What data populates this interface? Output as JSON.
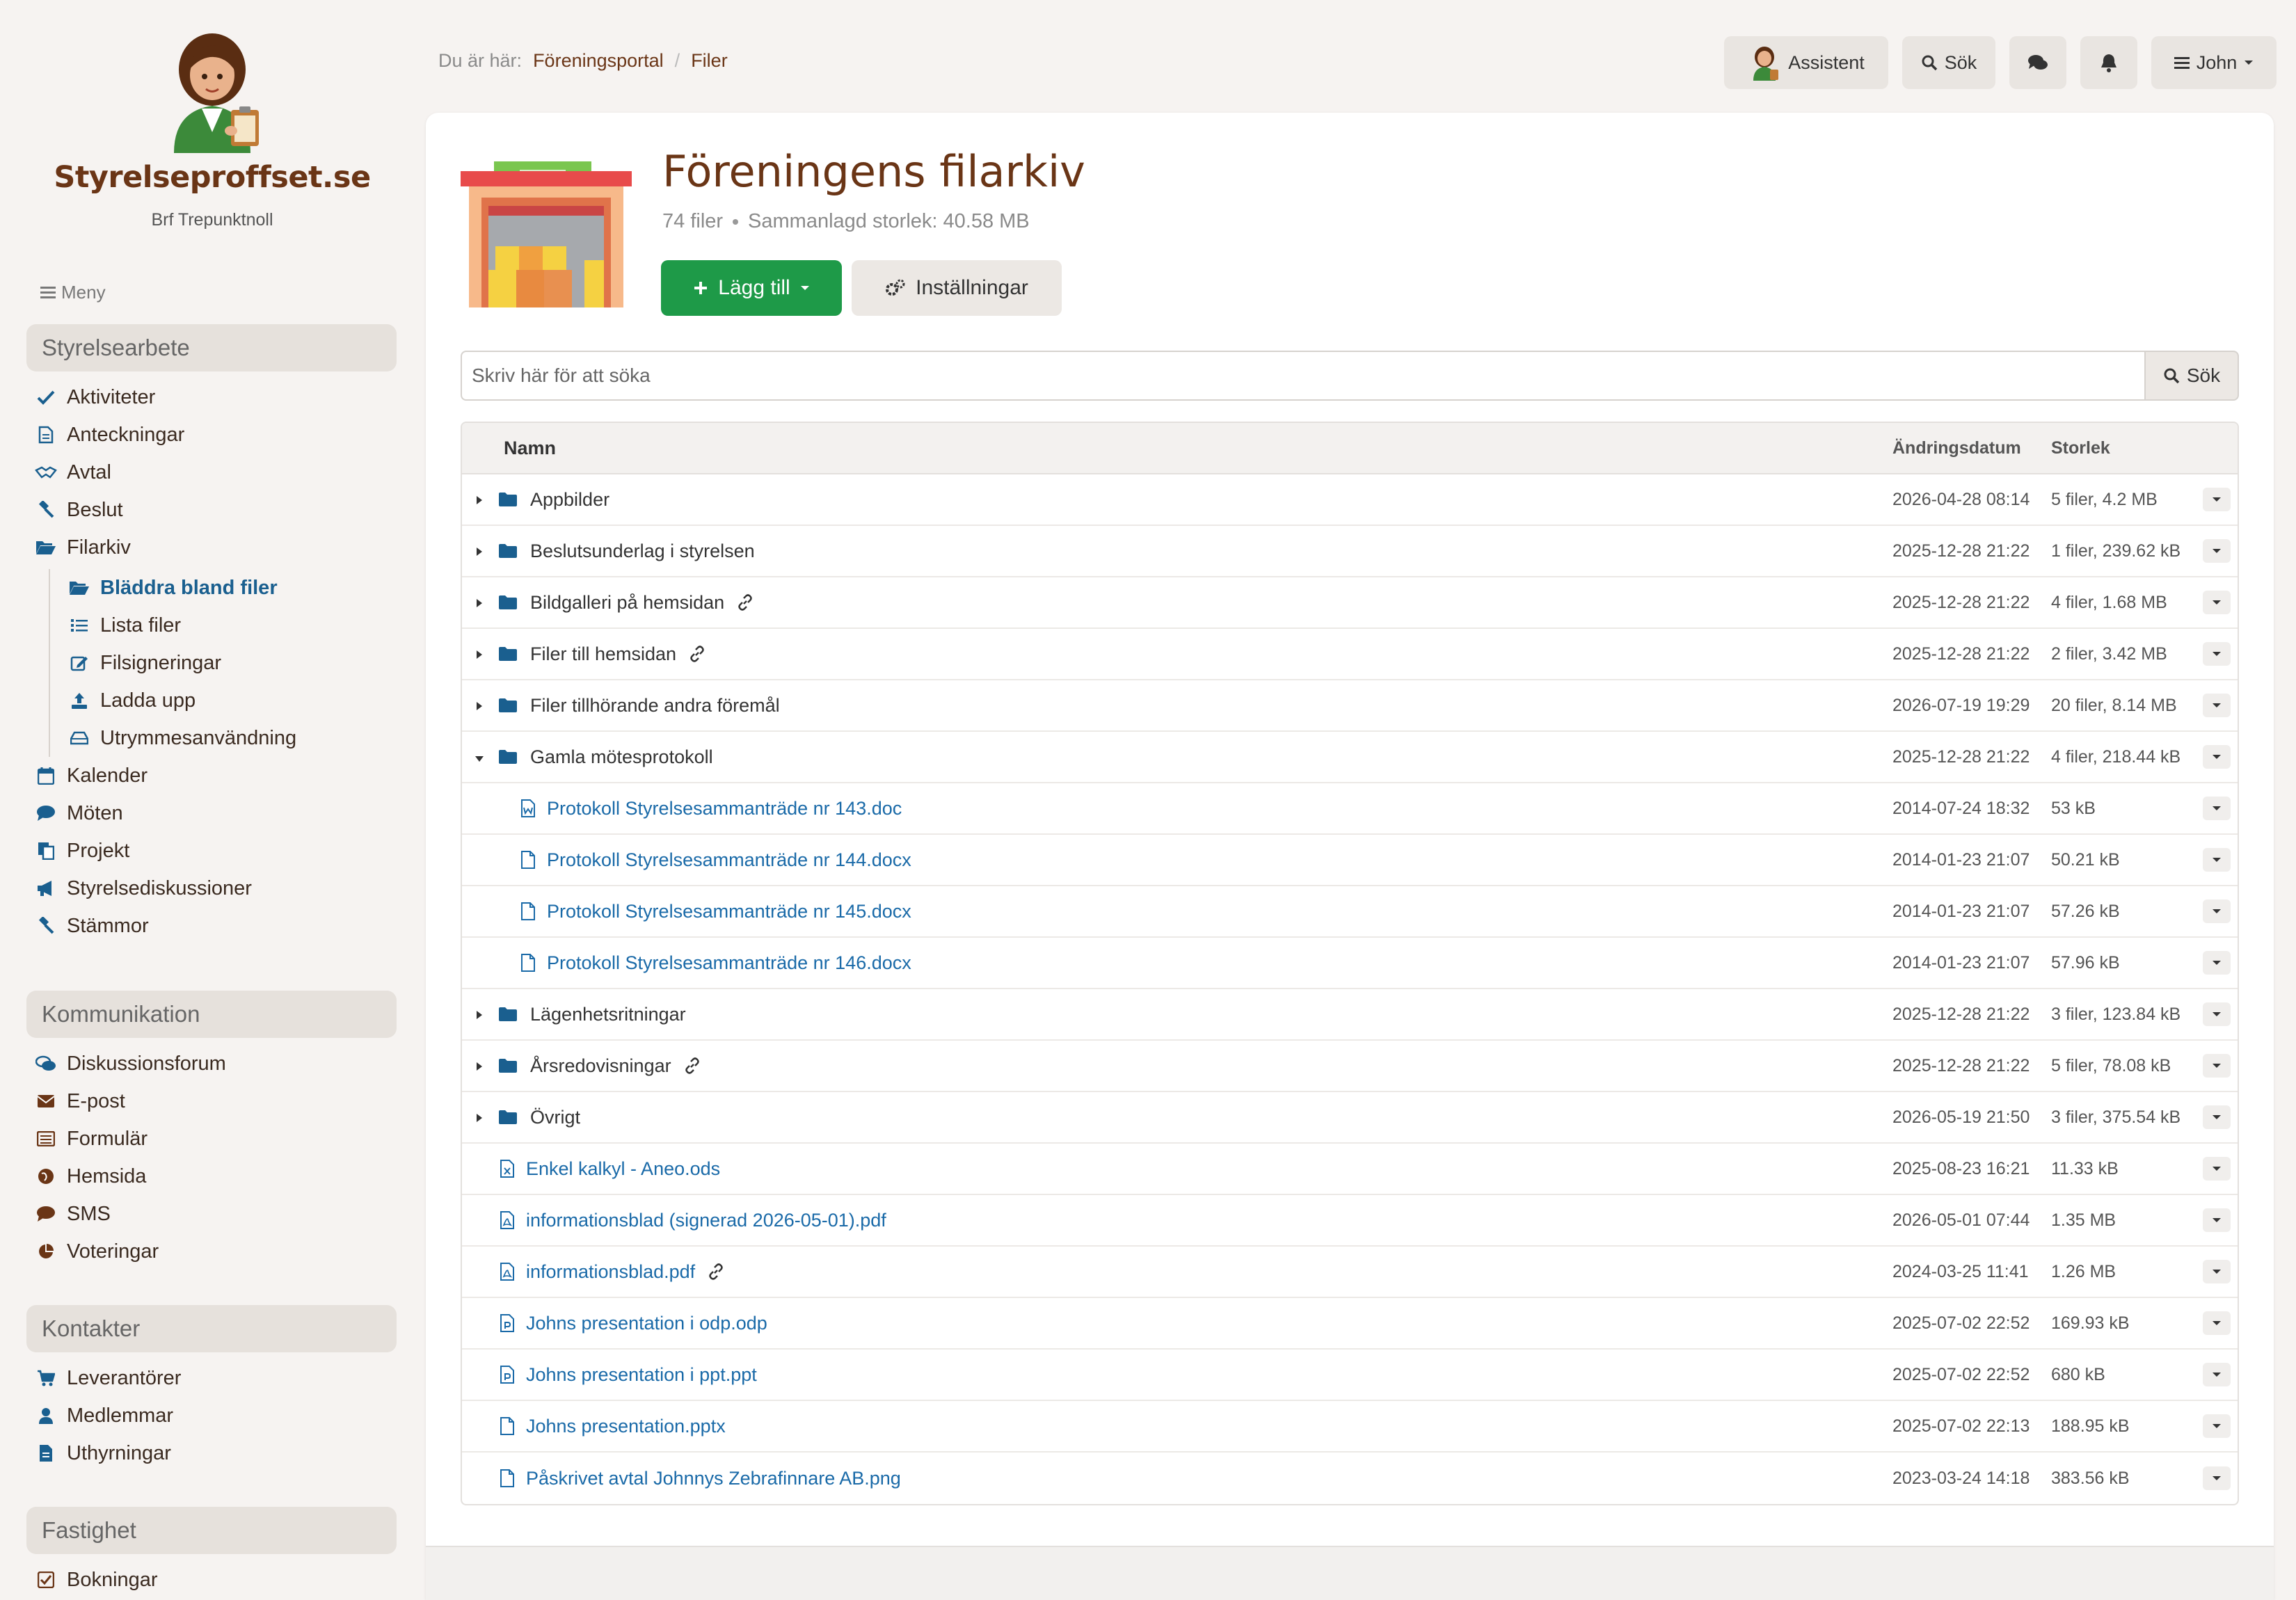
{
  "brand": {
    "name": "Styrelseproffset.se",
    "subtitle": "Brf Trepunktnoll"
  },
  "menu_label": "Meny",
  "sidebar": {
    "sections": [
      {
        "title": "Styrelsearbete",
        "items": [
          {
            "label": "Aktiviteter",
            "icon": "check-icon"
          },
          {
            "label": "Anteckningar",
            "icon": "note-icon"
          },
          {
            "label": "Avtal",
            "icon": "handshake-icon"
          },
          {
            "label": "Beslut",
            "icon": "gavel-icon"
          },
          {
            "label": "Filarkiv",
            "icon": "folder-open-icon"
          }
        ],
        "sub_items": [
          {
            "label": "Bläddra bland filer",
            "icon": "folder-open-icon",
            "active": true
          },
          {
            "label": "Lista filer",
            "icon": "list-icon"
          },
          {
            "label": "Filsigneringar",
            "icon": "edit-icon"
          },
          {
            "label": "Ladda upp",
            "icon": "upload-icon"
          },
          {
            "label": "Utrymmesanvändning",
            "icon": "drive-icon"
          }
        ],
        "items_after": [
          {
            "label": "Kalender",
            "icon": "calendar-icon"
          },
          {
            "label": "Möten",
            "icon": "comment-icon"
          },
          {
            "label": "Projekt",
            "icon": "copy-icon"
          },
          {
            "label": "Styrelsediskussioner",
            "icon": "megaphone-icon"
          },
          {
            "label": "Stämmor",
            "icon": "gavel-icon"
          }
        ]
      },
      {
        "title": "Kommunikation",
        "items": [
          {
            "label": "Diskussionsforum",
            "icon": "comments-icon"
          },
          {
            "label": "E-post",
            "icon": "envelope-icon"
          },
          {
            "label": "Formulär",
            "icon": "form-icon"
          },
          {
            "label": "Hemsida",
            "icon": "globe-icon"
          },
          {
            "label": "SMS",
            "icon": "sms-icon"
          },
          {
            "label": "Voteringar",
            "icon": "pie-chart-icon"
          }
        ]
      },
      {
        "title": "Kontakter",
        "items": [
          {
            "label": "Leverantörer",
            "icon": "cart-icon"
          },
          {
            "label": "Medlemmar",
            "icon": "user-icon"
          },
          {
            "label": "Uthyrningar",
            "icon": "document-icon"
          }
        ]
      },
      {
        "title": "Fastighet",
        "items": [
          {
            "label": "Bokningar",
            "icon": "checkbox-icon"
          }
        ]
      }
    ]
  },
  "breadcrumb": {
    "prefix": "Du är här:",
    "items": [
      "Föreningsportal",
      "Filer"
    ]
  },
  "topbar": {
    "assistant_label": "Assistent",
    "search_label": "Sök",
    "user_label": "John"
  },
  "page": {
    "title": "Föreningens filarkiv",
    "file_count": "74 filer",
    "total_size": "Sammanlagd storlek: 40.58 MB",
    "add_button": "Lägg till",
    "settings_button": "Inställningar",
    "search_placeholder": "Skriv här för att söka",
    "search_button": "Sök"
  },
  "table": {
    "headers": {
      "name": "Namn",
      "date": "Ändringsdatum",
      "size": "Storlek"
    },
    "rows": [
      {
        "type": "folder",
        "name": "Appbilder",
        "date": "2026-04-28 08:14",
        "size": "5 filer, 4.2 MB",
        "expanded": false,
        "linked": false,
        "level": 0
      },
      {
        "type": "folder",
        "name": "Beslutsunderlag i styrelsen",
        "date": "2025-12-28 21:22",
        "size": "1 filer, 239.62 kB",
        "expanded": false,
        "linked": false,
        "level": 0
      },
      {
        "type": "folder",
        "name": "Bildgalleri på hemsidan",
        "date": "2025-12-28 21:22",
        "size": "4 filer, 1.68 MB",
        "expanded": false,
        "linked": true,
        "level": 0
      },
      {
        "type": "folder",
        "name": "Filer till hemsidan",
        "date": "2025-12-28 21:22",
        "size": "2 filer, 3.42 MB",
        "expanded": false,
        "linked": true,
        "level": 0
      },
      {
        "type": "folder",
        "name": "Filer tillhörande andra föremål",
        "date": "2026-07-19 19:29",
        "size": "20 filer, 8.14 MB",
        "expanded": false,
        "linked": false,
        "level": 0
      },
      {
        "type": "folder",
        "name": "Gamla mötesprotokoll",
        "date": "2025-12-28 21:22",
        "size": "4 filer, 218.44 kB",
        "expanded": true,
        "linked": false,
        "level": 0
      },
      {
        "type": "file",
        "icon": "word-file-icon",
        "name": "Protokoll Styrelsesammanträde nr 143.doc",
        "date": "2014-07-24 18:32",
        "size": "53 kB",
        "linked": false,
        "level": 1
      },
      {
        "type": "file",
        "icon": "file-icon",
        "name": "Protokoll Styrelsesammanträde nr 144.docx",
        "date": "2014-01-23 21:07",
        "size": "50.21 kB",
        "linked": false,
        "level": 1
      },
      {
        "type": "file",
        "icon": "file-icon",
        "name": "Protokoll Styrelsesammanträde nr 145.docx",
        "date": "2014-01-23 21:07",
        "size": "57.26 kB",
        "linked": false,
        "level": 1
      },
      {
        "type": "file",
        "icon": "file-icon",
        "name": "Protokoll Styrelsesammanträde nr 146.docx",
        "date": "2014-01-23 21:07",
        "size": "57.96 kB",
        "linked": false,
        "level": 1
      },
      {
        "type": "folder",
        "name": "Lägenhetsritningar",
        "date": "2025-12-28 21:22",
        "size": "3 filer, 123.84 kB",
        "expanded": false,
        "linked": false,
        "level": 0
      },
      {
        "type": "folder",
        "name": "Årsredovisningar",
        "date": "2025-12-28 21:22",
        "size": "5 filer, 78.08 kB",
        "expanded": false,
        "linked": true,
        "level": 0
      },
      {
        "type": "folder",
        "name": "Övrigt",
        "date": "2026-05-19 21:50",
        "size": "3 filer, 375.54 kB",
        "expanded": false,
        "linked": false,
        "level": 0
      },
      {
        "type": "file",
        "icon": "spreadsheet-file-icon",
        "name": "Enkel kalkyl - Aneo.ods",
        "date": "2025-08-23 16:21",
        "size": "11.33 kB",
        "linked": false,
        "level": 0
      },
      {
        "type": "file",
        "icon": "pdf-file-icon",
        "name": "informationsblad (signerad 2026-05-01).pdf",
        "date": "2026-05-01 07:44",
        "size": "1.35 MB",
        "linked": false,
        "level": 0
      },
      {
        "type": "file",
        "icon": "pdf-file-icon",
        "name": "informationsblad.pdf",
        "date": "2024-03-25 11:41",
        "size": "1.26 MB",
        "linked": true,
        "level": 0
      },
      {
        "type": "file",
        "icon": "presentation-file-icon",
        "name": "Johns presentation i odp.odp",
        "date": "2025-07-02 22:52",
        "size": "169.93 kB",
        "linked": false,
        "level": 0
      },
      {
        "type": "file",
        "icon": "presentation-file-icon",
        "name": "Johns presentation i ppt.ppt",
        "date": "2025-07-02 22:52",
        "size": "680 kB",
        "linked": false,
        "level": 0
      },
      {
        "type": "file",
        "icon": "file-icon",
        "name": "Johns presentation.pptx",
        "date": "2025-07-02 22:13",
        "size": "188.95 kB",
        "linked": false,
        "level": 0
      },
      {
        "type": "file",
        "icon": "file-icon",
        "name": "Påskrivet avtal Johnnys Zebrafinnare AB.png",
        "date": "2023-03-24 14:18",
        "size": "383.56 kB",
        "linked": false,
        "level": 0
      }
    ]
  },
  "colors": {
    "brand": "#6a3516",
    "link": "#1a6aa8",
    "folder": "#1a5f8f",
    "primary_button": "#1e9a48",
    "active_nav": "#1a5f8f"
  }
}
